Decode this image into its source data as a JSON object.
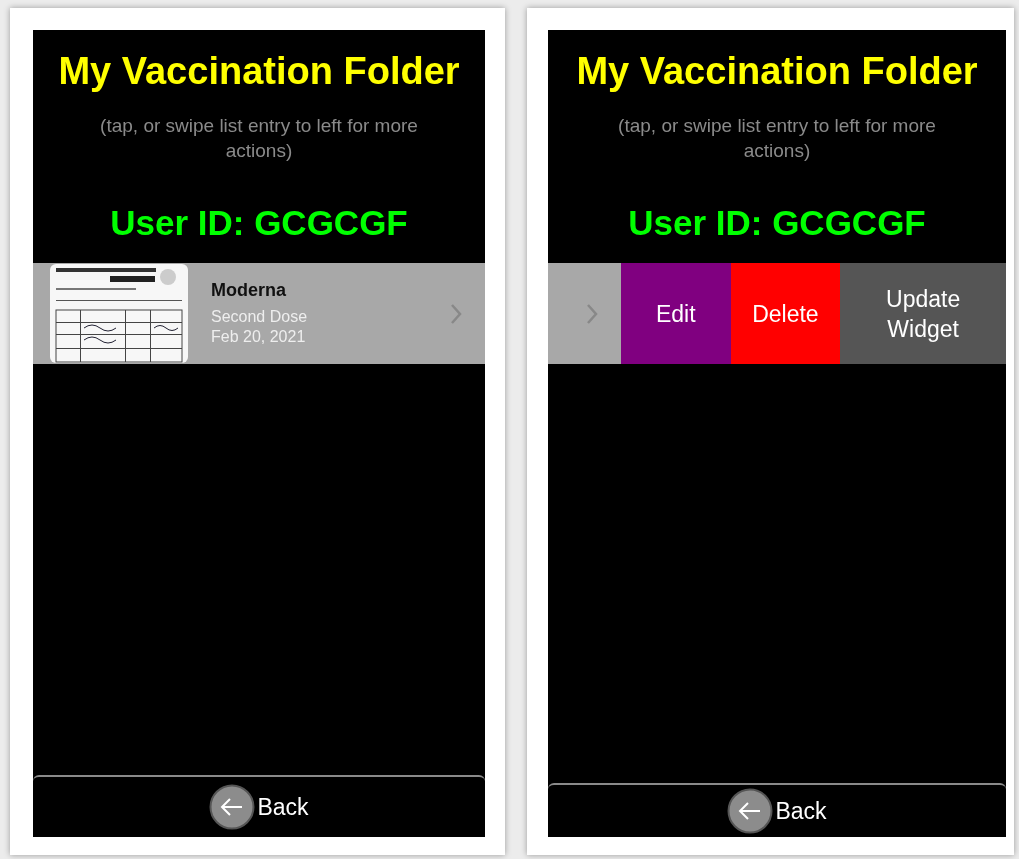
{
  "screens": [
    {
      "title": "My Vaccination Folder",
      "hint": "(tap, or swipe list entry to left for more actions)",
      "user_id": "User ID: GCGCGF",
      "row": {
        "kind": "entry",
        "name": "Moderna",
        "dose": "Second Dose",
        "date": "Feb 20, 2021"
      },
      "back": "Back"
    },
    {
      "title": "My Vaccination Folder",
      "hint": "(tap, or swipe list entry to left for more actions)",
      "user_id": "User ID: GCGCGF",
      "row": {
        "kind": "swiped",
        "actions": [
          {
            "label": "Edit",
            "color": "#800080"
          },
          {
            "label": "Delete",
            "color": "#ff0000"
          },
          {
            "label": "Update Widget",
            "color": "#555555"
          }
        ]
      },
      "back": "Back"
    }
  ]
}
